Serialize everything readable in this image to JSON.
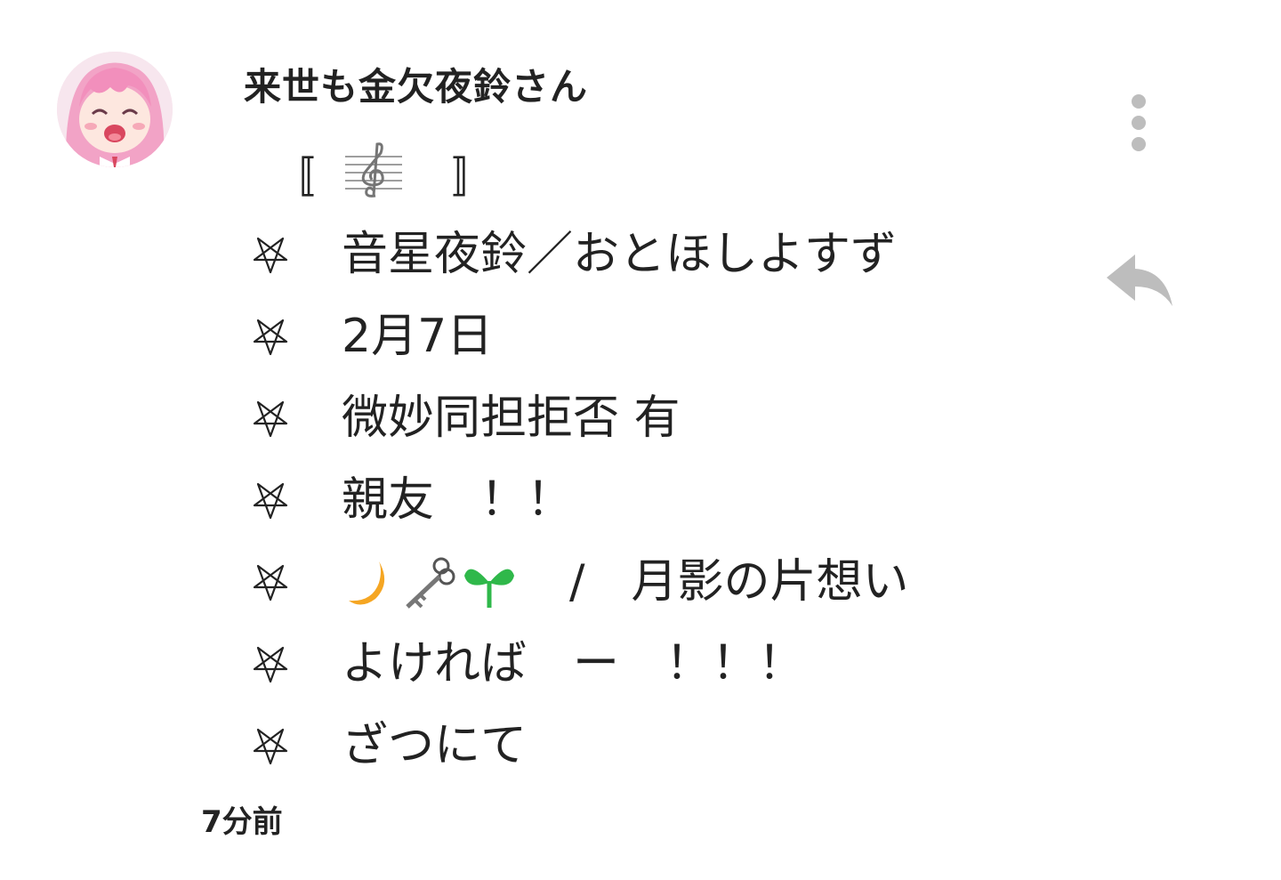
{
  "comment": {
    "username": "来世も金欠夜鈴さん",
    "timestamp": "7分前",
    "bracket_left": "〚",
    "bracket_right": "〛",
    "lines": [
      {
        "text": "音星夜鈴／おとほしよすず"
      },
      {
        "text": "2月7日"
      },
      {
        "text": "微妙同担拒否 有"
      },
      {
        "text": "親友　！！"
      },
      {
        "emojis": [
          "crescent-moon",
          "old-key",
          "seedling"
        ],
        "text": "/　月影の片想い"
      },
      {
        "text": "よければ　ー　！！！"
      },
      {
        "text": "ざつにて"
      }
    ]
  },
  "icons": {
    "more": "more-vertical-icon",
    "reply": "reply-icon",
    "bullet": "inverted-pentagram-icon",
    "clef": "treble-clef-icon"
  },
  "colors": {
    "icon_gray": "#bdbdbd",
    "text": "#222222",
    "moon": "#f5a623",
    "seedling": "#2fb84a"
  }
}
